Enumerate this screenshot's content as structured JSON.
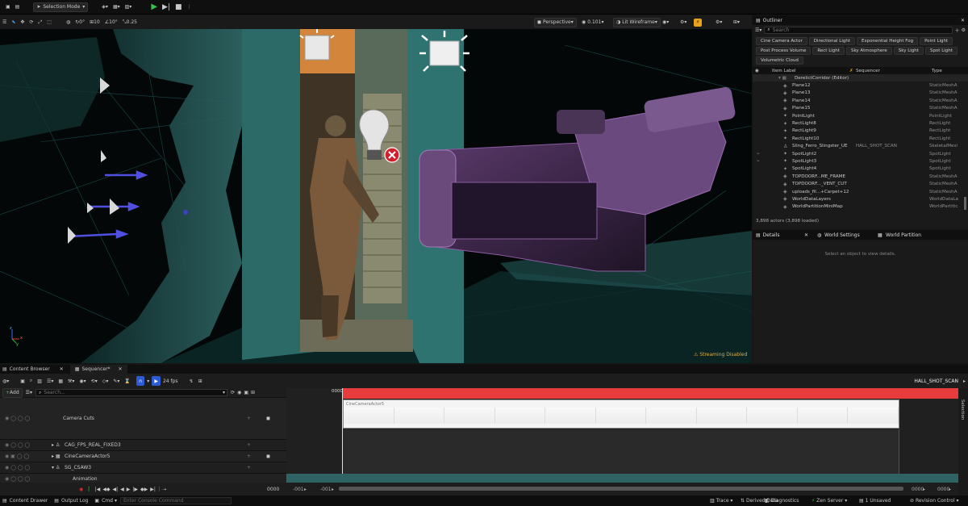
{
  "toolbar": {
    "mode": "Selection Mode"
  },
  "viewport": {
    "perspective": "Perspective",
    "fov": "0.101",
    "view_mode": "Lit Wireframe",
    "snap_values": [
      "0°",
      "10",
      "10°",
      "0.25"
    ],
    "streaming": "Streaming Disabled",
    "axis": [
      "z",
      "x",
      "y"
    ]
  },
  "outliner": {
    "tab": "Outliner",
    "search_placeholder": "Search",
    "filters": [
      "Cine Camera Actor",
      "Directional Light",
      "Exponential Height Fog",
      "Point Light",
      "Post Process Volume",
      "Rect Light",
      "Sky Atmosphere",
      "Sky Light",
      "Spot Light",
      "Volumetric Cloud"
    ],
    "headers": {
      "label": "Item Label",
      "sequencer": "Sequencer",
      "type": "Type"
    },
    "root": "DerelictCorridor (Editor)",
    "rows": [
      {
        "label": "Plane12",
        "seq": "",
        "type": "StaticMeshA"
      },
      {
        "label": "Plane13",
        "seq": "",
        "type": "StaticMeshA"
      },
      {
        "label": "Plane14",
        "seq": "",
        "type": "StaticMeshA"
      },
      {
        "label": "Plane15",
        "seq": "",
        "type": "StaticMeshA"
      },
      {
        "label": "PointLight",
        "seq": "",
        "type": "PointLight"
      },
      {
        "label": "RectLight8",
        "seq": "",
        "type": "RectLight"
      },
      {
        "label": "RectLight9",
        "seq": "",
        "type": "RectLight"
      },
      {
        "label": "RectLight10",
        "seq": "",
        "type": "RectLight"
      },
      {
        "label": "Sling_Ferro_Slingster_UE",
        "seq": "HALL_SHOT_SCAN",
        "type": "SkeletalMesl"
      },
      {
        "label": "SpotLight2",
        "seq": "",
        "type": "SpotLight"
      },
      {
        "label": "SpotLight3",
        "seq": "",
        "type": "SpotLight"
      },
      {
        "label": "SpotLight4",
        "seq": "",
        "type": "SpotLight"
      },
      {
        "label": "TOPDOORF...ME_FRAME",
        "seq": "",
        "type": "StaticMeshA"
      },
      {
        "label": "TOPDOORF..._VENT_CUT",
        "seq": "",
        "type": "StaticMeshA"
      },
      {
        "label": "uploads_fil...+Carpet+12",
        "seq": "",
        "type": "StaticMeshA"
      },
      {
        "label": "WorldDataLayers",
        "seq": "",
        "type": "WorldDataLa"
      },
      {
        "label": "WorldPartitionMiniMap",
        "seq": "",
        "type": "WorldPartitic"
      }
    ],
    "count": "3,898 actors (3,898 loaded)"
  },
  "details": {
    "tabs": [
      "Details",
      "World Settings",
      "World Partition"
    ],
    "empty": "Select an object to view details."
  },
  "bottom": {
    "tabs": [
      "Content Browser",
      "Sequencer"
    ],
    "sequence_name": "HALL_SHOT_SCAN",
    "fps": "24 fps",
    "add": "Add",
    "search_placeholder": "Search...",
    "tracks": [
      "Camera Cuts",
      "CAG_FPS_REAL_FIXED3",
      "CineCameraActor5",
      "SG_CSAW3",
      "Animation",
      "Transform"
    ],
    "clip_label": "CineCameraActor5",
    "frame_top": "0000",
    "frame": "0000",
    "range_start": "-001",
    "range_start2": "-001",
    "range_end": "0000",
    "range_end2": "0000",
    "side_label": "Selection"
  },
  "status": {
    "content_drawer": "Content Drawer",
    "output_log": "Output Log",
    "cmd": "Cmd",
    "console_placeholder": "Enter Console Command",
    "trace": "Trace",
    "derived_data": "Derived Data",
    "diagnostics": "Diagnostics",
    "zen": "Zen Server",
    "unsaved": "1 Unsaved",
    "revision": "Revision Control"
  }
}
